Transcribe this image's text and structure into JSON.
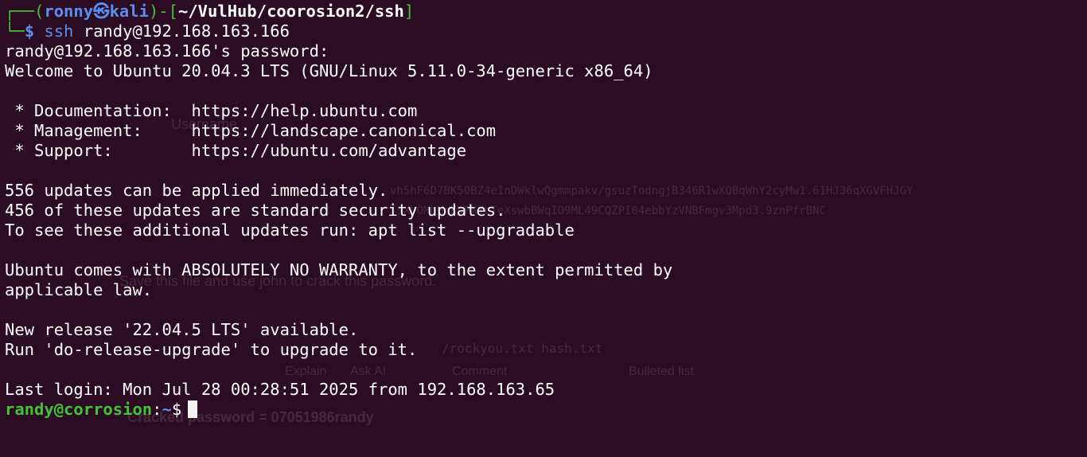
{
  "ghost": {
    "username_text": "Username",
    "hash_line_1": "vh5hF6D7BK50BZ4eInDWklwQgmmpakv/gsuzTodngjB346R1wXQBqWhY2cyMw1.61HJ36qXGVFHJGY",
    "hash_line_2": "T9XUOMhHcKDPXYLTeXswbBWqIO9ML49CQZPI04ebbYzVNBFmgv3Mpd3.9znPfrBNC",
    "save_file_text": "Save this file and use john to crack this password.",
    "john_cmd": "/rockyou.txt hash.txt",
    "toolbar_explain": "Explain",
    "toolbar_ask_ai": "Ask AI",
    "toolbar_comment": "Comment",
    "toolbar_bulleted": "Bulleted list",
    "cracked_text": "Cracked password = 07051986randy"
  },
  "prompt": {
    "user": "ronny",
    "skull": "㉿",
    "host": "kali",
    "path": "~/VulHub/coorosion2/ssh",
    "ssh_cmd": "ssh",
    "ssh_target": " randy@192.168.163.166"
  },
  "output": {
    "password_prompt": "randy@192.168.163.166's password:",
    "welcome": "Welcome to Ubuntu 20.04.3 LTS (GNU/Linux 5.11.0-34-generic x86_64)",
    "doc": " * Documentation:  https://help.ubuntu.com",
    "mgmt": " * Management:     https://landscape.canonical.com",
    "support": " * Support:        https://ubuntu.com/advantage",
    "updates_1": "556 updates can be applied immediately.",
    "updates_2": "456 of these updates are standard security updates.",
    "updates_3": "To see these additional updates run: apt list --upgradable",
    "warranty_1": "Ubuntu comes with ABSOLUTELY NO WARRANTY, to the extent permitted by",
    "warranty_2": "applicable law.",
    "release_1": "New release '22.04.5 LTS' available.",
    "release_2": "Run 'do-release-upgrade' to upgrade to it.",
    "last_login": "Last login: Mon Jul 28 00:28:51 2025 from 192.168.163.65"
  },
  "remote_prompt": {
    "userhost": "randy@corrosion",
    "path": "~",
    "symbol": "$"
  },
  "colors": {
    "background": "#2c0c22",
    "prompt_green": "#44c237",
    "prompt_blue": "#5b8ef0",
    "text": "#ffffff"
  }
}
